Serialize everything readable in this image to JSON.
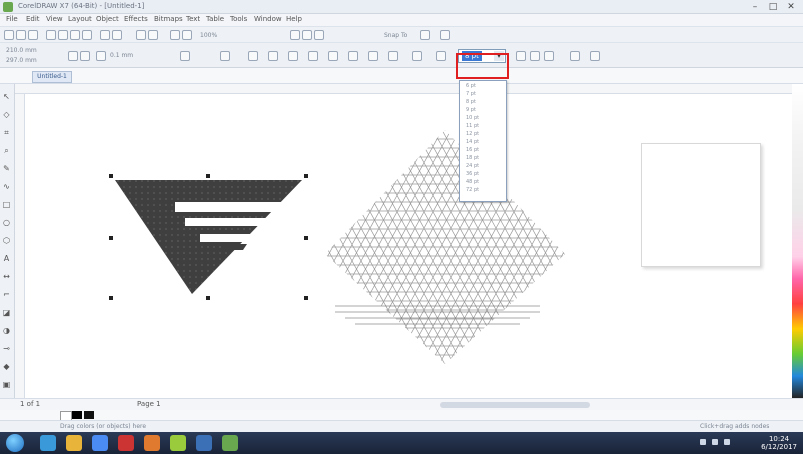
{
  "window": {
    "title": "CorelDRAW X7 (64-Bit) - [Untitled-1]",
    "buttons": {
      "minimize": "–",
      "maximize": "□",
      "close": "✕"
    }
  },
  "menu": [
    "File",
    "Edit",
    "View",
    "Layout",
    "Object",
    "Effects",
    "Bitmaps",
    "Text",
    "Table",
    "Tools",
    "Window",
    "Help"
  ],
  "toolbar": {
    "snap_label": "Snap To",
    "zoom_label": "100%",
    "width_label": "210.0 mm",
    "height_label": "297.0 mm",
    "nudge_label": "0.1 mm",
    "font_size_value": "8 pt"
  },
  "document_tab": "Untitled-1",
  "font_size_options": [
    "6 pt",
    "7 pt",
    "8 pt",
    "9 pt",
    "10 pt",
    "11 pt",
    "12 pt",
    "14 pt",
    "16 pt",
    "18 pt",
    "24 pt",
    "36 pt",
    "48 pt",
    "72 pt"
  ],
  "page_nav": {
    "text": "1 of 1",
    "page_label": "Page 1"
  },
  "status": {
    "left": "Drag colors (or objects) here",
    "right": "Click+drag adds nodes"
  },
  "taskbar": {
    "time": "10:24",
    "date": "6/12/2017"
  },
  "colors": {
    "accent": "#3a78d3",
    "highlight": "#e02020",
    "shape_fill": "#3f3f3f",
    "lattice_stroke": "#9a9a9a"
  },
  "icons": {
    "app": "coreldraw-icon",
    "start": "windows-start-icon"
  }
}
